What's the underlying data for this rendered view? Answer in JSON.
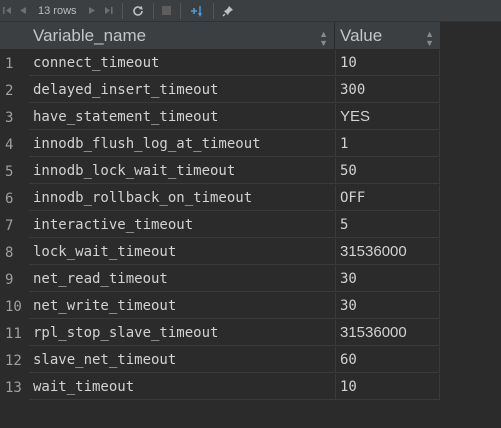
{
  "toolbar": {
    "rows_label": "13 rows",
    "icons": [
      "first-page-icon",
      "prev-page-icon",
      "next-page-icon",
      "last-page-icon",
      "refresh-icon",
      "stop-icon",
      "sort-icon",
      "pin-icon"
    ]
  },
  "table": {
    "columns": [
      "Variable_name",
      "Value"
    ],
    "rows": [
      {
        "n": "1",
        "name": "connect_timeout",
        "value": "10"
      },
      {
        "n": "2",
        "name": "delayed_insert_timeout",
        "value": "300"
      },
      {
        "n": "3",
        "name": "have_statement_timeout",
        "value": "YES"
      },
      {
        "n": "4",
        "name": "innodb_flush_log_at_timeout",
        "value": "1"
      },
      {
        "n": "5",
        "name": "innodb_lock_wait_timeout",
        "value": "50"
      },
      {
        "n": "6",
        "name": "innodb_rollback_on_timeout",
        "value": "OFF"
      },
      {
        "n": "7",
        "name": "interactive_timeout",
        "value": "5"
      },
      {
        "n": "8",
        "name": "lock_wait_timeout",
        "value": "31536000"
      },
      {
        "n": "9",
        "name": "net_read_timeout",
        "value": "30"
      },
      {
        "n": "10",
        "name": "net_write_timeout",
        "value": "30"
      },
      {
        "n": "11",
        "name": "rpl_stop_slave_timeout",
        "value": "31536000"
      },
      {
        "n": "12",
        "name": "slave_net_timeout",
        "value": "60"
      },
      {
        "n": "13",
        "name": "wait_timeout",
        "value": "10"
      }
    ]
  },
  "colors": {
    "background": "#2b2b2b",
    "header": "#3c3f41",
    "accent": "#4a9be3"
  }
}
